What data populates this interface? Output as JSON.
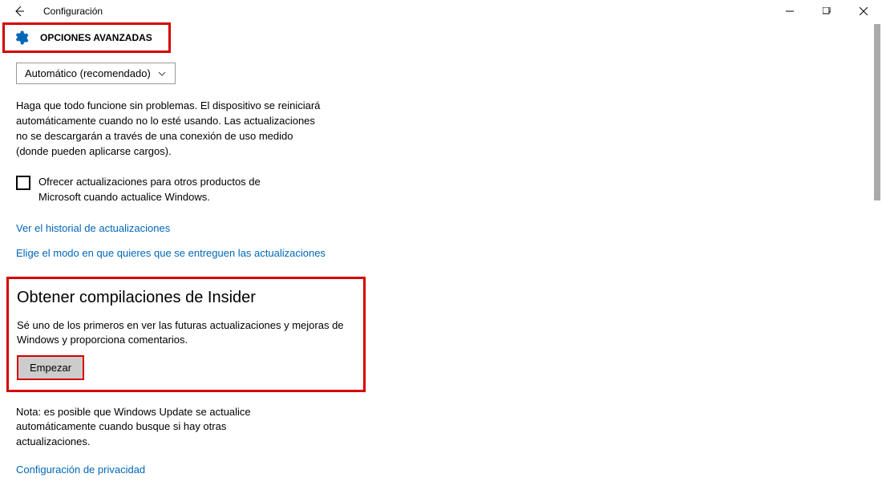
{
  "titlebar": {
    "title": "Configuración"
  },
  "header": {
    "heading": "OPCIONES AVANZADAS"
  },
  "dropdown": {
    "selected": "Automático (recomendado)"
  },
  "main": {
    "description": "Haga que todo funcione sin problemas. El dispositivo se reiniciará automáticamente cuando no lo esté usando. Las actualizaciones no se descargarán a través de una conexión de uso medido (donde pueden aplicarse cargos).",
    "checkbox_label": "Ofrecer actualizaciones para otros productos de Microsoft cuando actualice Windows.",
    "link_history": "Ver el historial de actualizaciones",
    "link_delivery": "Elige el modo en que quieres que se entreguen las actualizaciones"
  },
  "insider": {
    "heading": "Obtener compilaciones de Insider",
    "description": "Sé uno de los primeros en ver las futuras actualizaciones y mejoras de Windows y proporciona comentarios.",
    "button_label": "Empezar"
  },
  "footer": {
    "note": "Nota: es posible que Windows Update se actualice automáticamente cuando busque si hay otras actualizaciones.",
    "privacy_link": "Configuración de privacidad"
  }
}
